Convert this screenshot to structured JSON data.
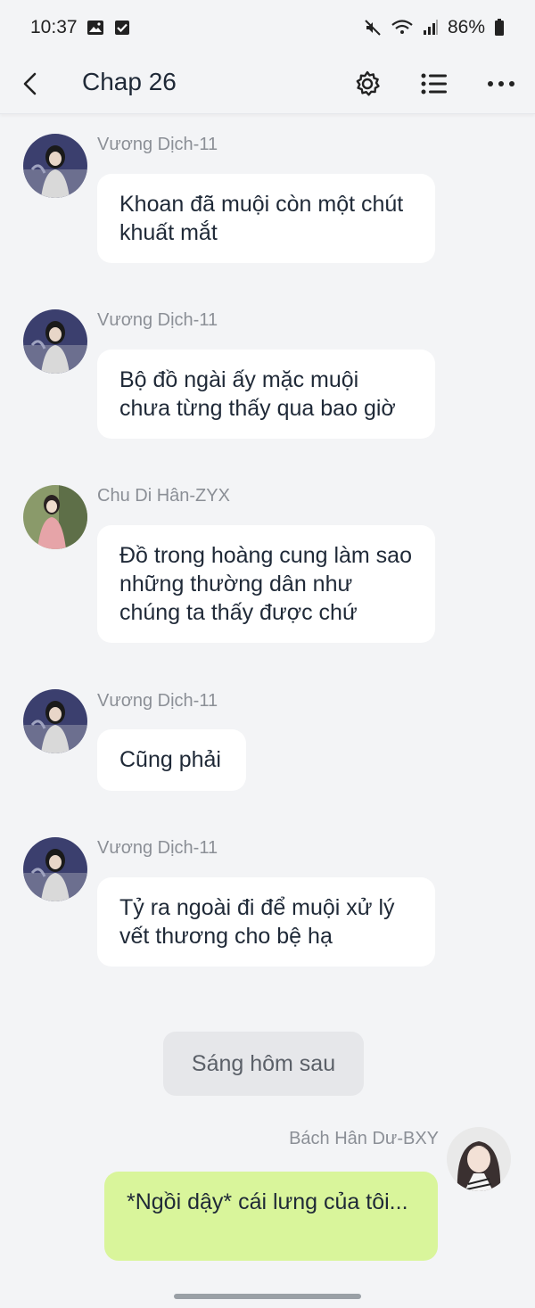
{
  "status": {
    "time": "10:37",
    "battery": "86%"
  },
  "header": {
    "title": "Chap 26"
  },
  "messages": [
    {
      "sender": "Vương Dịch-11",
      "text": "Khoan đã muội còn một chút khuất mắt"
    },
    {
      "sender": "Vương Dịch-11",
      "text": "Bộ đồ ngài ấy mặc muội chưa từng thấy qua bao giờ"
    },
    {
      "sender": "Chu Di Hân-ZYX",
      "text": "Đồ trong hoàng cung làm sao những thường dân như chúng ta thấy được chứ"
    },
    {
      "sender": "Vương Dịch-11",
      "text": "Cũng phải"
    },
    {
      "sender": "Vương Dịch-11",
      "text": "Tỷ ra ngoài đi để muội xử lý vết thương cho bệ hạ"
    }
  ],
  "narration": "Sáng hôm sau",
  "my_message": {
    "sender": "Bách Hân Dư-BXY",
    "text": "*Ngồi dậy* cái lưng của tôi..."
  },
  "colors": {
    "background": "#f3f4f6",
    "bubble": "#ffffff",
    "my_bubble": "#d9f59b"
  }
}
